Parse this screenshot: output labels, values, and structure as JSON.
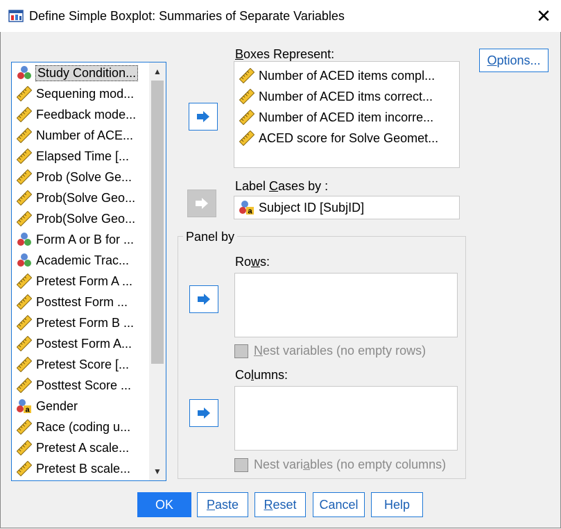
{
  "window": {
    "title": "Define Simple Boxplot: Summaries of Separate Variables",
    "close_glyph": "✕"
  },
  "variables": [
    {
      "label": "Study Condition...",
      "icon": "nominal-icon",
      "selected": true
    },
    {
      "label": "Sequening mod...",
      "icon": "scale-icon"
    },
    {
      "label": "Feedback mode...",
      "icon": "scale-icon"
    },
    {
      "label": "Number of ACE...",
      "icon": "scale-icon"
    },
    {
      "label": "Elapsed Time [...",
      "icon": "scale-icon"
    },
    {
      "label": "Prob (Solve Ge...",
      "icon": "scale-icon"
    },
    {
      "label": "Prob(Solve Geo...",
      "icon": "scale-icon"
    },
    {
      "label": "Prob(Solve Geo...",
      "icon": "scale-icon"
    },
    {
      "label": "Form A or B for ...",
      "icon": "nominal-icon"
    },
    {
      "label": "Academic Trac...",
      "icon": "nominal-icon"
    },
    {
      "label": "Pretest Form A ...",
      "icon": "scale-icon"
    },
    {
      "label": "Posttest Form ...",
      "icon": "scale-icon"
    },
    {
      "label": "Pretest Form B ...",
      "icon": "scale-icon"
    },
    {
      "label": "Postest Form A...",
      "icon": "scale-icon"
    },
    {
      "label": "Pretest Score [...",
      "icon": "scale-icon"
    },
    {
      "label": "Posttest Score ...",
      "icon": "scale-icon"
    },
    {
      "label": "Gender",
      "icon": "string-nominal-icon"
    },
    {
      "label": "Race (coding u...",
      "icon": "scale-icon"
    },
    {
      "label": "Pretest A scale...",
      "icon": "scale-icon"
    },
    {
      "label": "Pretest B scale...",
      "icon": "scale-icon"
    }
  ],
  "boxes_represent": {
    "label_pre": "",
    "label_ul": "B",
    "label_post": "oxes Represent:",
    "items": [
      {
        "label": "Number of ACED items compl...",
        "icon": "scale-icon"
      },
      {
        "label": "Number of ACED itms correct...",
        "icon": "scale-icon"
      },
      {
        "label": "Number of ACED item incorre...",
        "icon": "scale-icon"
      },
      {
        "label": "ACED score for Solve Geomet...",
        "icon": "scale-icon"
      }
    ]
  },
  "label_cases": {
    "label_pre": "Label ",
    "label_ul": "C",
    "label_post": "ases by :",
    "value": "Subject ID [SubjID]",
    "icon": "string-nominal-icon"
  },
  "panel_by": {
    "title": "Panel by",
    "rows_pre": "Ro",
    "rows_ul": "w",
    "rows_post": "s:",
    "nest_rows_pre": "N",
    "nest_rows_ul": "",
    "nest_rows_post": "est variables (no empty rows)",
    "columns_pre": "Co",
    "columns_ul": "l",
    "columns_post": "umns:",
    "nest_cols_pre": "Nest vari",
    "nest_cols_ul": "a",
    "nest_cols_post": "bles (no empty columns)"
  },
  "buttons": {
    "options": {
      "pre": "",
      "ul": "O",
      "post": "ptions..."
    },
    "ok": "OK",
    "paste": {
      "pre": "",
      "ul": "P",
      "post": "aste"
    },
    "reset": {
      "pre": "",
      "ul": "R",
      "post": "eset"
    },
    "cancel": "Cancel",
    "help": "Help"
  },
  "colors": {
    "accent": "#1e78d7",
    "primary_button": "#1e78f0"
  }
}
